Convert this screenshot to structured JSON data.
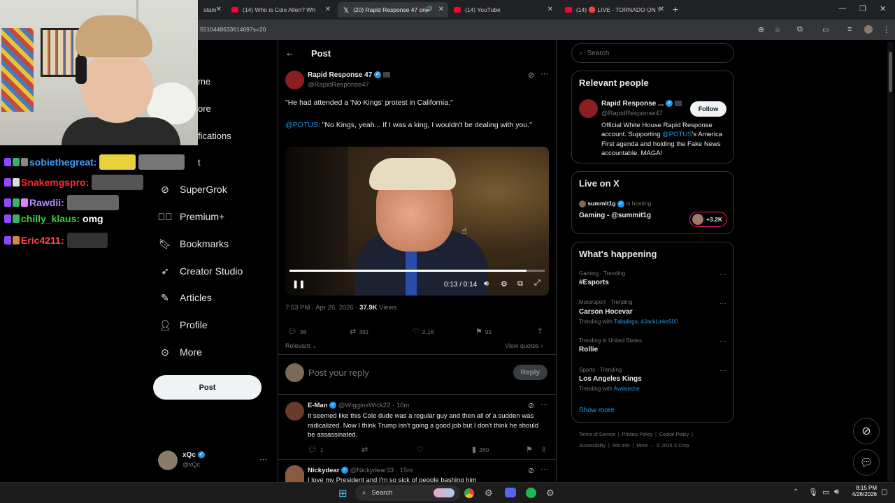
{
  "browser": {
    "tabs": [
      {
        "title": "stam",
        "active": false
      },
      {
        "title": "(14) Who is Cole Allen? Wh",
        "active": false
      },
      {
        "title": "(20) Rapid Response 47 on",
        "active": true
      },
      {
        "title": "(14) YouTube",
        "active": false
      },
      {
        "title": "(14) 🔴 LIVE - TORNADO ON T",
        "active": false
      }
    ],
    "new_tab": "+",
    "url": "5510448633614697s=20"
  },
  "chat": [
    {
      "user": "sobiethegreat:",
      "color": "#3aa0ff",
      "msg": ""
    },
    {
      "user": "Snakemgspro:",
      "color": "#ff2a2a",
      "msg": ""
    },
    {
      "user": "Rawdii:",
      "color": "#b48cff",
      "msg": ""
    },
    {
      "user": "chilly_klaus:",
      "color": "#37d437",
      "msg": "omg"
    },
    {
      "user": "Eric4211:",
      "color": "#ff4a4a",
      "msg": ""
    }
  ],
  "nav": {
    "partial_items": [
      "me",
      "ore",
      "fications",
      "t"
    ],
    "items": [
      {
        "label": "SuperGrok",
        "icon": "supergrok-icon"
      },
      {
        "label": "Premium+",
        "icon": "premium-icon"
      },
      {
        "label": "Bookmarks",
        "icon": "bookmark-icon"
      },
      {
        "label": "Creator Studio",
        "icon": "rocket-icon"
      },
      {
        "label": "Articles",
        "icon": "article-icon"
      },
      {
        "label": "Profile",
        "icon": "profile-icon"
      },
      {
        "label": "More",
        "icon": "more-icon"
      }
    ],
    "post_button": "Post",
    "account": {
      "name": "xQc",
      "handle": "@xQc"
    }
  },
  "post": {
    "header_title": "Post",
    "author_name": "Rapid Response 47",
    "author_handle": "@RapidResponse47",
    "text_line1": "\"He had attended a 'No Kings' protest in California.\"",
    "mention": "@POTUS",
    "text_line2": ": \"No Kings, yeah... If I was a king, I wouldn't be dealing with you.\"",
    "video_time": "0:13 / 0:14",
    "video_progress": 0.93,
    "timestamp": "7:53 PM · Apr 26, 2026 · ",
    "views_count": "37.9K",
    "views_label": " Views",
    "stats": {
      "replies": "96",
      "reposts": "391",
      "likes": "2.1K",
      "bookmarks": "91"
    },
    "sort_label": "Relevant",
    "view_quotes": "View quotes",
    "reply_placeholder": "Post your reply",
    "reply_button": "Reply"
  },
  "replies": [
    {
      "name": "E-Man",
      "handle": "@WigginsWick22 · 10m",
      "text": "It seemed like this Cole dude was a regular guy and then all of a sudden was radicalized. Now I think Trump isn't going a good job but I don't think he should be assassinated.",
      "replies": "1",
      "views": "260"
    },
    {
      "name": "Nickydear",
      "handle": "@Nickydear33 · 15m",
      "text": "I love my President and I'm so sick of people bashing him"
    }
  ],
  "sidebar": {
    "search_placeholder": "Search",
    "relevant_title": "Relevant people",
    "person_name": "Rapid Response ...",
    "person_handle": "@RapidResponse47",
    "follow_label": "Follow",
    "bio_1": "Official White House Rapid Response account. Supporting ",
    "bio_mention": "@POTUS",
    "bio_2": "'s America First agenda and holding the Fake News accountable. MAGA!",
    "live_title": "Live on X",
    "live_host": "summit1g",
    "live_hosting": " is hosting",
    "live_show": "Gaming - @summit1g",
    "live_count": "+3.2K",
    "happening_title": "What's happening",
    "trends": [
      {
        "sub": "Gaming · Trending",
        "name": "#Esports",
        "extra_label": "",
        "extra_links": ""
      },
      {
        "sub": "Motorsport · Trending",
        "name": "Carson Hocevar",
        "extra_label": "Trending with ",
        "extra_links": "Talladega, #JackLinks500"
      },
      {
        "sub": "Trending in United States",
        "name": "Rollie",
        "extra_label": "",
        "extra_links": ""
      },
      {
        "sub": "Sports · Trending",
        "name": "Los Angeles Kings",
        "extra_label": "Trending with ",
        "extra_links": "Avalanche"
      }
    ],
    "show_more": "Show more",
    "footer_1": "Terms of Service  |  Privacy Policy  |  Cookie Policy  |",
    "footer_2": "Accessibility  |  Ads info  |  More ···  © 2026 X Corp."
  },
  "taskbar": {
    "search_label": "Search",
    "time": "8:15 PM",
    "date": "4/26/2026"
  },
  "colors": {
    "accent": "#1d9bf0",
    "background": "#000000",
    "border": "#2f3336"
  }
}
